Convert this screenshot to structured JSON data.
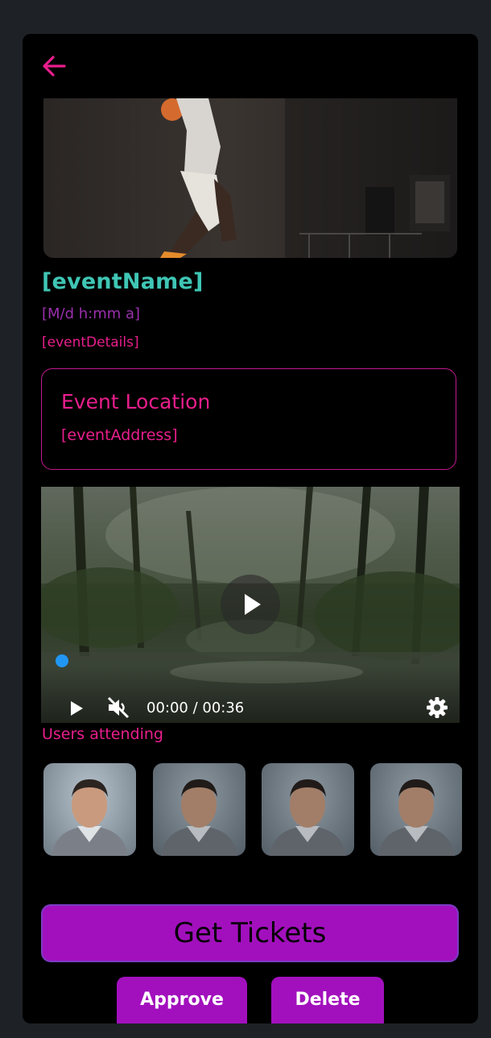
{
  "nav": {
    "back_icon": "arrow-left-icon",
    "accent_color": "#e91e8c"
  },
  "event": {
    "name": "[eventName]",
    "date": "[M/d h:mm a]",
    "details": "[eventDetails]"
  },
  "location": {
    "title": "Event Location",
    "address": "[eventAddress]"
  },
  "video": {
    "time": "00:00 / 00:36",
    "progress": 0,
    "muted": true,
    "icons": [
      "play-icon",
      "mute-icon",
      "settings-icon"
    ]
  },
  "users": {
    "label": "Users attending",
    "count_visible": 4
  },
  "actions": {
    "get_tickets": "Get Tickets",
    "approve": "Approve",
    "delete": "Delete"
  },
  "colors": {
    "title": "#3fc6b5",
    "date": "#9b2fae",
    "pink": "#e91e8c",
    "button": "#a210bd",
    "progress": "#2196f3"
  }
}
